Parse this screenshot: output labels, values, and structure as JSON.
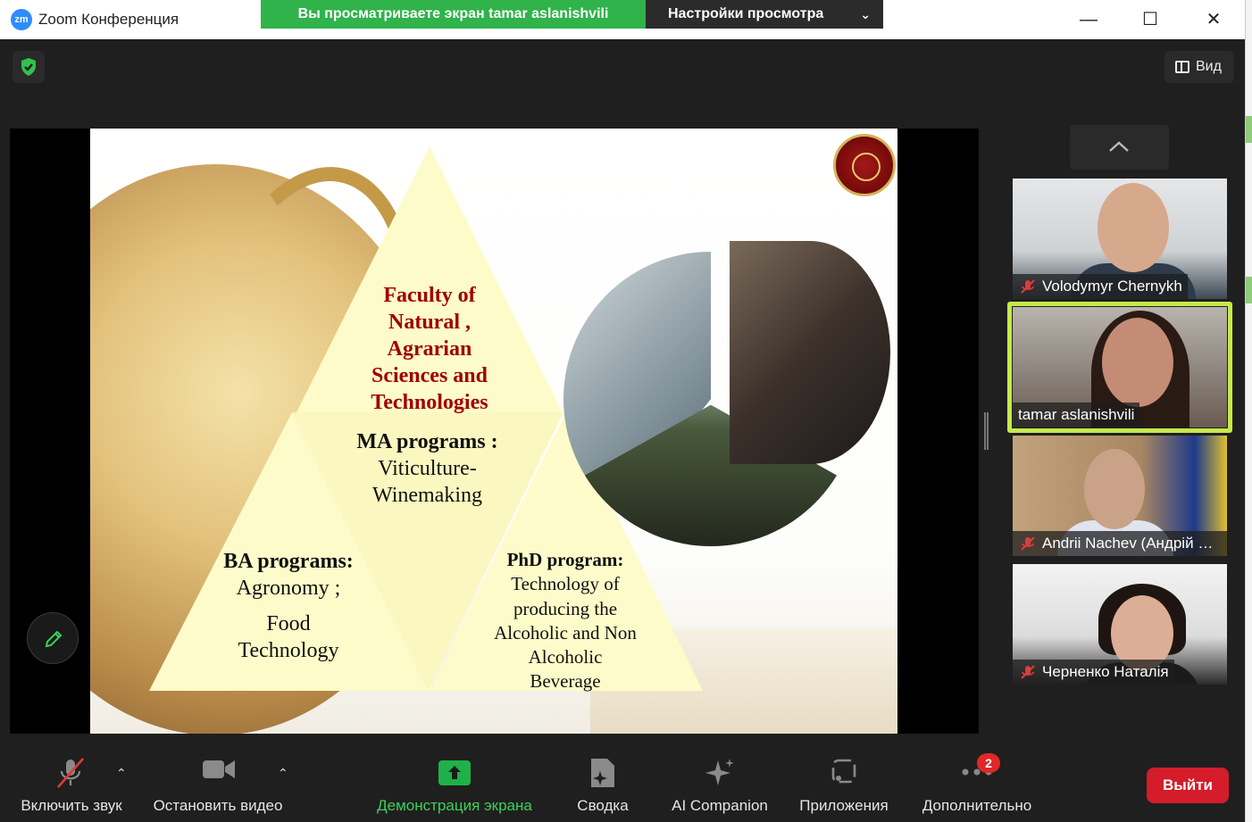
{
  "window": {
    "app_logo": "zm",
    "title": "Zoom Конференция"
  },
  "share_banner": {
    "viewing_text": "Вы просматриваете экран tamar aslanishvili",
    "view_options_label": "Настройки просмотра"
  },
  "header": {
    "view_button_label": "Вид"
  },
  "slide": {
    "faculty": "Faculty of Natural , Agrarian Sciences and Technologies",
    "ma_title": "MA programs :",
    "ma_body": "Viticulture-Winemaking",
    "ba_title": "BA programs:",
    "ba_body_1": "Agronomy ;",
    "ba_body_2": "Food Technology",
    "phd_title": "PhD program:",
    "phd_body": "Technology of producing the Alcoholic and Non Alcoholic Beverage"
  },
  "participants": [
    {
      "name": "Volodymyr Chernykh",
      "muted": true
    },
    {
      "name": "tamar aslanishvili",
      "muted": false,
      "active_speaker": true
    },
    {
      "name": "Andrii Nachev (Андрій Начев)",
      "muted": true
    },
    {
      "name": "Черненко Наталія",
      "muted": true
    }
  ],
  "toolbar": {
    "mute_label": "Включить звук",
    "video_label": "Остановить видео",
    "share_label": "Демонстрация экрана",
    "summary_label": "Сводка",
    "ai_label": "AI Companion",
    "apps_label": "Приложения",
    "more_label": "Дополнительно",
    "more_badge": "2",
    "leave_label": "Выйти"
  },
  "colors": {
    "share_green": "#2fb34a",
    "leave_red": "#d41c2a",
    "active_border": "#c6e94a",
    "faculty_red": "#a00000"
  }
}
